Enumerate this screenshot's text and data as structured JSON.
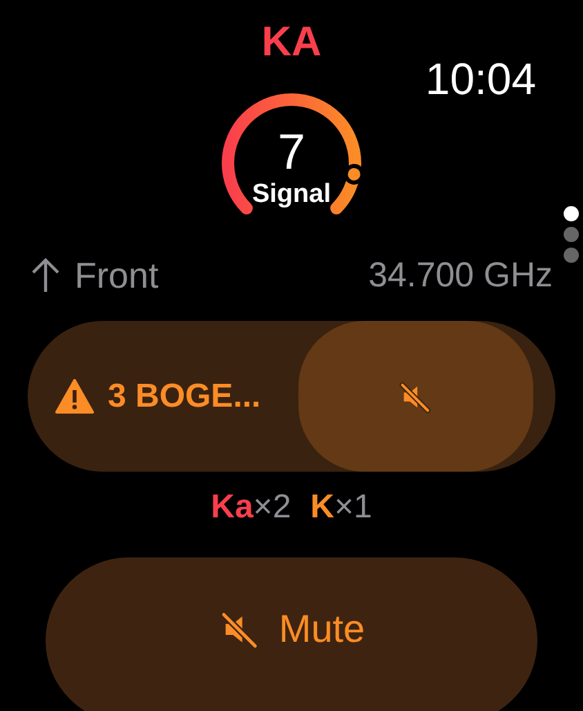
{
  "title": "KA",
  "time": "10:04",
  "gauge": {
    "value": "7",
    "label": "Signal"
  },
  "pages": [
    {
      "selected": true
    },
    {
      "selected": false
    },
    {
      "selected": false
    }
  ],
  "direction": {
    "label": "Front"
  },
  "frequency": {
    "value": "34.700",
    "unit": "GHz"
  },
  "alert": {
    "label": "3 BOGE...",
    "mute_on": true
  },
  "bands": [
    {
      "name": "Ka",
      "count": "×2",
      "color": "#fa3f4c"
    },
    {
      "name": "K",
      "count": "×1",
      "color": "#fb8c26"
    }
  ],
  "mute_button": {
    "label": "Mute"
  }
}
